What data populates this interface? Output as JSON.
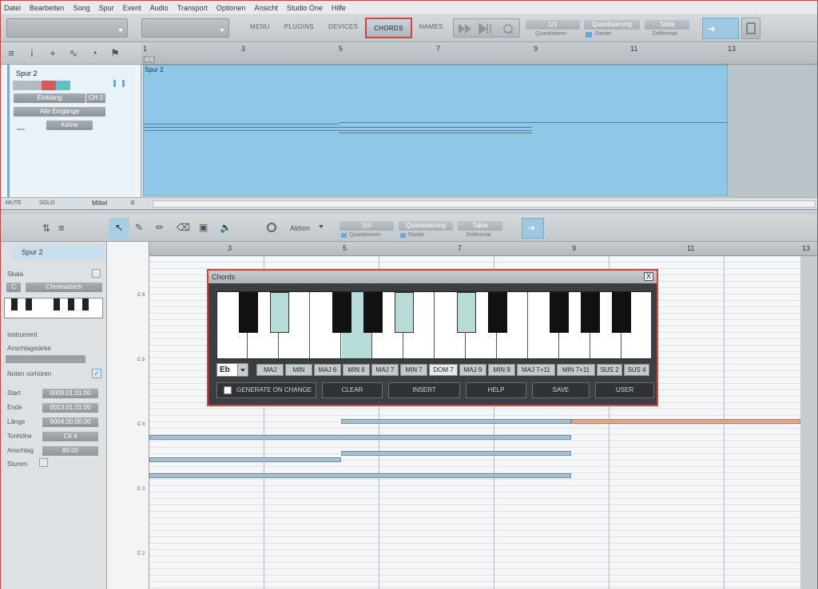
{
  "menu": [
    "Datei",
    "Bearbeiten",
    "Song",
    "Spur",
    "Event",
    "Audio",
    "Transport",
    "Optionen",
    "Ansicht",
    "Studio One",
    "Hilfe"
  ],
  "toolbar": {
    "tabs": [
      {
        "label": "MENU",
        "active": false
      },
      {
        "label": "PLUGINS",
        "active": false
      },
      {
        "label": "DEVICES",
        "active": false
      },
      {
        "label": "CHORDS",
        "active": true
      },
      {
        "label": "NAMES",
        "active": false
      }
    ],
    "quantize_value": "1/1",
    "quantize_label": "Quantisieren",
    "quantize_mode": "Quantisierung",
    "raster_label": "Raster",
    "timeformat_value": "Takte",
    "timeformat_label": "Zeitformat"
  },
  "arranger": {
    "ruler_marks": [
      "1",
      "3",
      "5",
      "7",
      "9",
      "11",
      "13"
    ],
    "time_signature": "4/4",
    "track_name": "Spur 2",
    "event_label": "Spur 2",
    "instrument": "Einklang",
    "channel": "CH 1",
    "input": "Alle Eingänge",
    "output": "Keine",
    "bottom_labels": {
      "mute": "MUTE",
      "solo": "SOLO",
      "size": "Mittel"
    }
  },
  "editor": {
    "action_label": "Aktion",
    "quantize_value": "1/4",
    "quantize_label": "Quantisieren",
    "quantize_mode": "Quantisierung",
    "raster_label": "Raster",
    "timeformat_value": "Takte",
    "timeformat_label": "Zeitformat",
    "ruler_marks": [
      "3",
      "5",
      "7",
      "9",
      "11",
      "13"
    ],
    "note_labels": [
      "C 6",
      "C 5",
      "C 4",
      "C 3",
      "C 2"
    ]
  },
  "inspector": {
    "track_name": "Spur 2",
    "scale_label": "Skala",
    "scale_root": "C",
    "scale_type": "Chromatisch",
    "instrument_label": "Instrument",
    "velocity_label": "Anschlagstärke",
    "audition_label": "Noten vorhören",
    "fields": [
      {
        "label": "Start",
        "value": "0009.01.01.00"
      },
      {
        "label": "Ende",
        "value": "0013.01.01.00"
      },
      {
        "label": "Länge",
        "value": "0004.00.00.00"
      },
      {
        "label": "Tonhöhe",
        "value": "C# 4"
      },
      {
        "label": "Anschlag",
        "value": "80.00"
      }
    ],
    "mute_label": "Stumm"
  },
  "chords_dialog": {
    "title": "Chords",
    "close": "X",
    "key": "Eb",
    "chord_types": [
      "MAJ",
      "MIN",
      "MAJ 6",
      "MIN 6",
      "MAJ 7",
      "MIN 7",
      "DOM 7",
      "MAJ 9",
      "MIN 9",
      "MAJ 7+11",
      "MIN 7+11",
      "SUS 2",
      "SUS 4"
    ],
    "selected_chord": "DOM 7",
    "generate_label": "GENERATE ON CHANGE",
    "buttons": [
      "CLEAR",
      "INSERT",
      "HELP",
      "SAVE",
      "USER"
    ],
    "highlight_color": "#b7dcd8"
  }
}
